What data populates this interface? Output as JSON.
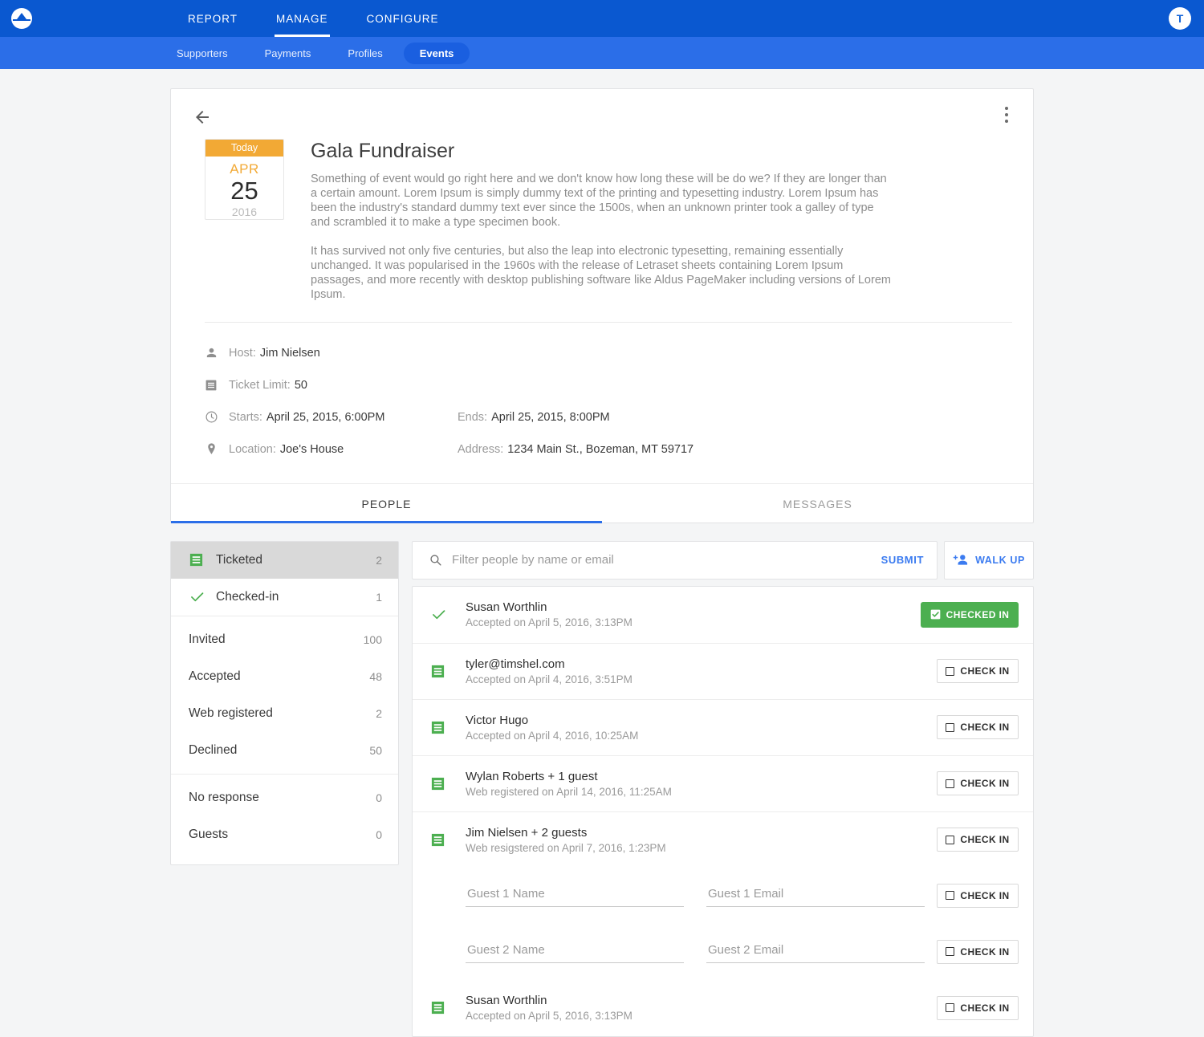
{
  "header": {
    "logo_icon": "brand-circle-triangle-icon",
    "nav": [
      {
        "label": "REPORT",
        "active": false
      },
      {
        "label": "MANAGE",
        "active": true
      },
      {
        "label": "CONFIGURE",
        "active": false
      }
    ],
    "avatar_initial": "T",
    "subnav": [
      {
        "label": "Supporters",
        "active": false
      },
      {
        "label": "Payments",
        "active": false
      },
      {
        "label": "Profiles",
        "active": false
      },
      {
        "label": "Events",
        "active": true
      }
    ]
  },
  "event": {
    "back_icon": "back-arrow-icon",
    "menu_icon": "kebab-menu-icon",
    "date_badge": {
      "today": "Today",
      "month": "APR",
      "day": "25",
      "year": "2016"
    },
    "title": "Gala Fundraiser",
    "description_1": "Something of event would go right here and we don't know how long these will be do we? If they are longer than a certain amount. Lorem Ipsum is simply dummy text of the printing and typesetting industry. Lorem Ipsum has been the industry's standard dummy text ever since the 1500s, when an unknown printer took a galley of type and scrambled it to make a type specimen book.",
    "description_2": "It has survived not only five centuries, but also the leap into electronic typesetting, remaining essentially unchanged. It was popularised in the 1960s with the release of Letraset sheets containing Lorem Ipsum passages, and more recently with desktop publishing software like Aldus PageMaker including versions of Lorem Ipsum.",
    "meta": {
      "host_label": "Host:",
      "host_value": "Jim Nielsen",
      "ticket_label": "Ticket Limit:",
      "ticket_value": "50",
      "starts_label": "Starts:",
      "starts_value": "April 25, 2015, 6:00PM",
      "ends_label": "Ends:",
      "ends_value": "April 25, 2015, 8:00PM",
      "location_label": "Location:",
      "location_value": "Joe's House",
      "address_label": "Address:",
      "address_value": "1234 Main St., Bozeman, MT 59717"
    },
    "tabs": [
      {
        "label": "PEOPLE",
        "active": true
      },
      {
        "label": "MESSAGES",
        "active": false
      }
    ]
  },
  "sidebar": {
    "group1": [
      {
        "label": "Ticketed",
        "count": "2",
        "icon": "ticket-icon",
        "selected": true
      },
      {
        "label": "Checked-in",
        "count": "1",
        "icon": "check-icon",
        "selected": false
      }
    ],
    "group2": [
      {
        "label": "Invited",
        "count": "100"
      },
      {
        "label": "Accepted",
        "count": "48"
      },
      {
        "label": "Web registered",
        "count": "2"
      },
      {
        "label": "Declined",
        "count": "50"
      }
    ],
    "group3": [
      {
        "label": "No response",
        "count": "0"
      },
      {
        "label": "Guests",
        "count": "0"
      }
    ]
  },
  "people_panel": {
    "search": {
      "placeholder": "Filter people by name or email",
      "value": "",
      "icon": "search-icon"
    },
    "submit_label": "SUBMIT",
    "walkup_label": "WALK UP",
    "walkup_icon": "person-add-icon",
    "checkin_label": "CHECK IN",
    "checkedin_label": "CHECKED IN",
    "rows": [
      {
        "type": "person",
        "icon": "check-icon",
        "name": "Susan Worthlin",
        "sub": "Accepted on April 5, 2016, 3:13PM",
        "state": "checked-in"
      },
      {
        "type": "person",
        "icon": "ticket-icon",
        "name": "tyler@timshel.com",
        "sub": "Accepted on April 4, 2016, 3:51PM",
        "state": "pending"
      },
      {
        "type": "person",
        "icon": "ticket-icon",
        "name": "Victor Hugo",
        "sub": "Accepted on April 4, 2016, 10:25AM",
        "state": "pending"
      },
      {
        "type": "person",
        "icon": "ticket-icon",
        "name": "Wylan Roberts + 1 guest",
        "sub": "Web registered on April 14, 2016, 11:25AM",
        "state": "pending"
      },
      {
        "type": "person",
        "icon": "ticket-icon",
        "name": "Jim Nielsen + 2 guests",
        "sub": "Web resigstered on April 7, 2016, 1:23PM",
        "state": "pending"
      },
      {
        "type": "guest",
        "name_placeholder": "Guest 1 Name",
        "email_placeholder": "Guest 1 Email",
        "name_value": "",
        "email_value": "",
        "state": "pending"
      },
      {
        "type": "guest",
        "name_placeholder": "Guest 2 Name",
        "email_placeholder": "Guest 2 Email",
        "name_value": "",
        "email_value": "",
        "state": "pending"
      },
      {
        "type": "person",
        "icon": "ticket-icon",
        "name": "Susan Worthlin",
        "sub": "Accepted on April 5, 2016, 3:13PM",
        "state": "pending"
      }
    ]
  },
  "colors": {
    "primary_blue": "#0a58d0",
    "sub_blue": "#2b6ee8",
    "accent_link": "#3b7bf0",
    "green": "#4caf50",
    "orange": "#f2a935"
  }
}
